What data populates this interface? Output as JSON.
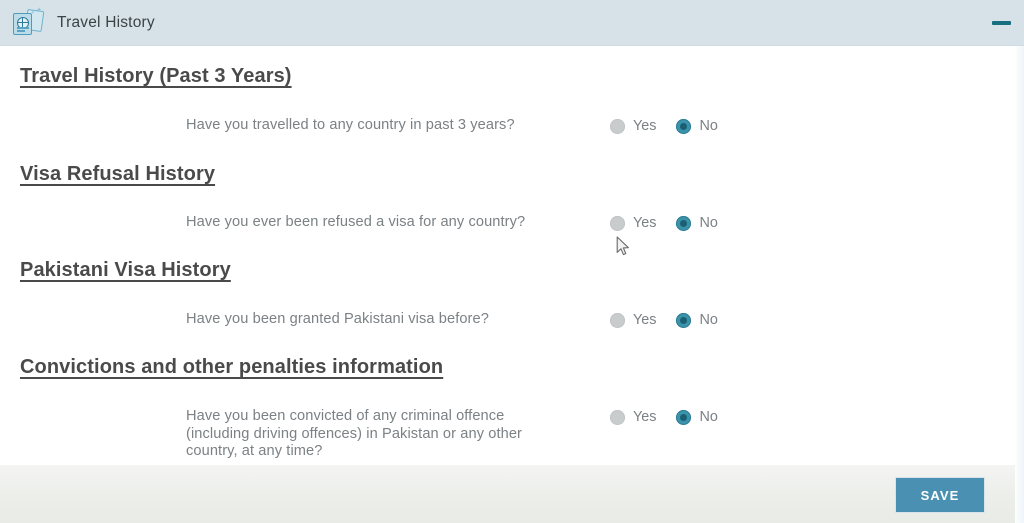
{
  "header": {
    "title": "Travel History",
    "icon": "travel-documents-icon",
    "minimize_icon": "minimize-icon",
    "background_color": "#d7e2e8"
  },
  "colors": {
    "accent": "#4a90b2",
    "radio_selected": "#3b93ab",
    "radio_unselected": "#c9cccd",
    "heading_text": "#4a4a4a",
    "body_text": "#7b8184",
    "minimize": "#16707f"
  },
  "radio_options": {
    "yes": "Yes",
    "no": "No"
  },
  "sections": [
    {
      "heading": "Travel History (Past 3 Years)",
      "question_lines": [
        "Have you travelled to any country in past 3 years?"
      ],
      "selected": "No"
    },
    {
      "heading": "Visa Refusal History",
      "question_lines": [
        "Have you ever been refused a visa for any country?"
      ],
      "selected": "No"
    },
    {
      "heading": "Pakistani Visa History",
      "question_lines": [
        "Have you been granted Pakistani visa before?"
      ],
      "selected": "No"
    },
    {
      "heading": "Convictions and other penalties information",
      "question_lines": [
        "Have you been convicted of any criminal offence",
        "(including driving offences) in Pakistan or any other",
        "country, at any time?"
      ],
      "selected": "No"
    }
  ],
  "footer": {
    "save_label": "SAVE"
  }
}
